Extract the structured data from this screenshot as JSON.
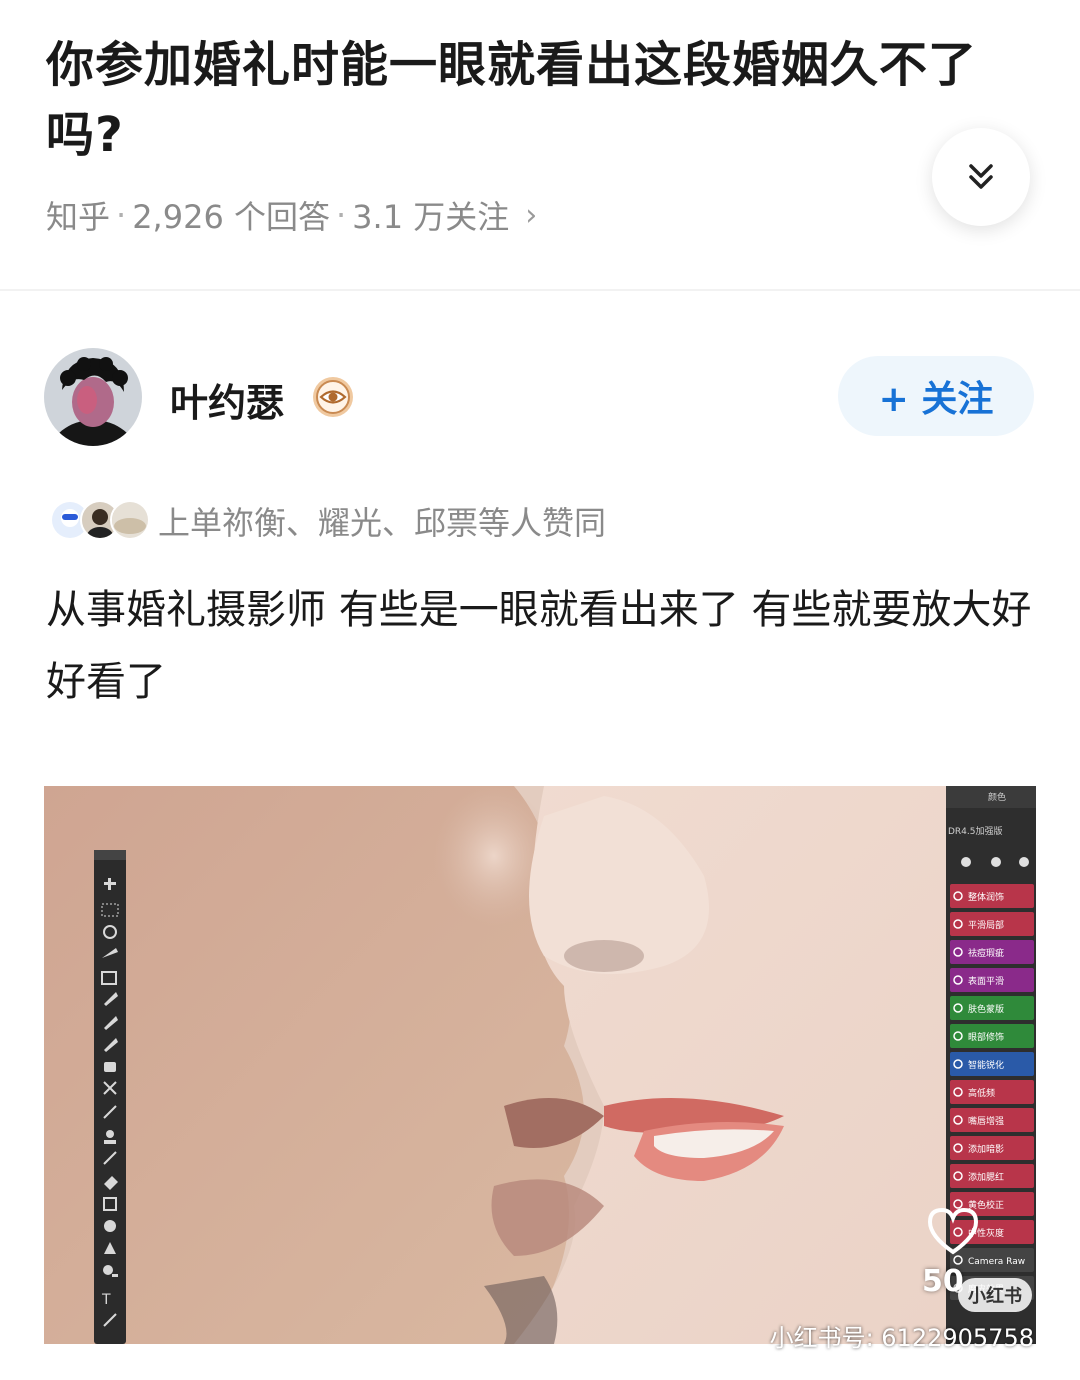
{
  "question": {
    "title": "你参加婚礼时能一眼就看出这段婚姻久不了吗?",
    "source": "知乎",
    "answers": "2,926 个回答",
    "followers": "3.1 万关注"
  },
  "author": {
    "name": "叶约瑟",
    "follow_label": "+ 关注"
  },
  "votes": {
    "text": "上单祢衡、耀光、邱票等人赞同"
  },
  "answer": {
    "text": "从事婚礼摄影师 有些是一眼就看出来了 有些就要放大好好看了"
  },
  "image": {
    "panel_top_tab": "颜色",
    "panel_title": "DR4.5加强版",
    "panel_items": [
      "整体润饰",
      "平滑局部",
      "祛痘瑕疵",
      "表面平滑",
      "肤色蒙版",
      "眼部修饰",
      "智能锐化",
      "高低频",
      "嘴唇增强",
      "添加暗影",
      "添加腮红",
      "黄色校正",
      "中性灰度",
      "Camera Raw",
      "磨皮效果"
    ],
    "like_count": "50",
    "app_logo": "小红书",
    "watermark": "小红书号: 6122905758"
  },
  "colors": {
    "follow_text": "#1772d6",
    "follow_bg": "#eef6fc",
    "meta_gray": "#8a8a8a"
  }
}
